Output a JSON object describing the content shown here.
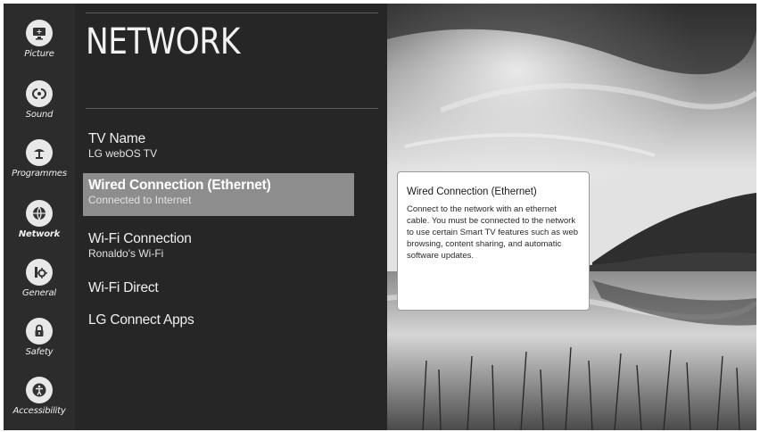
{
  "sidebar": {
    "items": [
      {
        "label": "Picture",
        "icon": "picture-icon"
      },
      {
        "label": "Sound",
        "icon": "sound-icon"
      },
      {
        "label": "Programmes",
        "icon": "programmes-icon"
      },
      {
        "label": "Network",
        "icon": "network-icon",
        "active": true
      },
      {
        "label": "General",
        "icon": "general-icon"
      },
      {
        "label": "Safety",
        "icon": "lock-icon"
      },
      {
        "label": "Accessibility",
        "icon": "accessibility-icon"
      }
    ]
  },
  "page": {
    "title": "NETWORK"
  },
  "menu": {
    "items": [
      {
        "title": "TV Name",
        "subtitle": "LG webOS TV"
      },
      {
        "title": "Wired Connection (Ethernet)",
        "subtitle": "Connected to Internet",
        "selected": true
      },
      {
        "title": "Wi-Fi Connection",
        "subtitle": "Ronaldo's Wi-Fi"
      },
      {
        "title": "Wi-Fi Direct"
      },
      {
        "title": "LG Connect Apps"
      }
    ]
  },
  "tooltip": {
    "title": "Wired Connection (Ethernet)",
    "body": "Connect to the network with an ethernet cable. You must be connected to the network to use certain Smart TV features such as web browsing, content sharing, and automatic software updates."
  }
}
